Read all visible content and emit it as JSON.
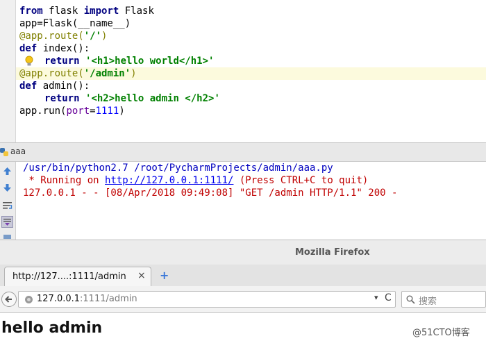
{
  "editor": {
    "lines": [
      {
        "t1": "from",
        "t2": " flask ",
        "t3": "import",
        "t4": " Flask"
      },
      {
        "text": "app=Flask(__name__)"
      },
      {
        "deco": "@app.route(",
        "arg": "'/'",
        "close": ")"
      },
      {
        "kw": "def",
        "rest": " index():"
      },
      {
        "kw": "return",
        "str": "'<h1>hello world</h1>'"
      },
      {
        "deco": "@app.route(",
        "arg": "'/admin'",
        "close": ")"
      },
      {
        "kw": "def",
        "rest": " admin():"
      },
      {
        "kw": "return",
        "str": "'<h2>hello admin </h2>'"
      },
      {
        "pre": "app.run(",
        "param": "port",
        "eq": "=",
        "num": "1111",
        "close": ")"
      }
    ]
  },
  "run_panel": {
    "title": "aaa",
    "console": [
      {
        "text": "/usr/bin/python2.7 /root/PycharmProjects/admin/aaa.py"
      },
      {
        "pre": " * Running on ",
        "link": "http://127.0.0.1:1111/",
        "post": " (Press CTRL+C to quit)"
      },
      {
        "text": "127.0.0.1 - - [08/Apr/2018 09:49:08] \"GET /admin HTTP/1.1\" 200 -"
      }
    ]
  },
  "browser": {
    "window_title": "Mozilla Firefox",
    "tab_label": "http://127....:1111/admin",
    "tab_close": "×",
    "new_tab": "+",
    "url_host": "127.0.0.1",
    "url_rest": ":1111/admin",
    "dropdown": "▾",
    "reload": "C",
    "search_placeholder": "搜索",
    "page_heading": "hello admin"
  },
  "watermark": "@51CTO博客",
  "colors": {
    "keyword": "#000080",
    "string": "#008000",
    "decorator": "#808000",
    "console_blue": "#0000c0",
    "console_red": "#c00000"
  }
}
